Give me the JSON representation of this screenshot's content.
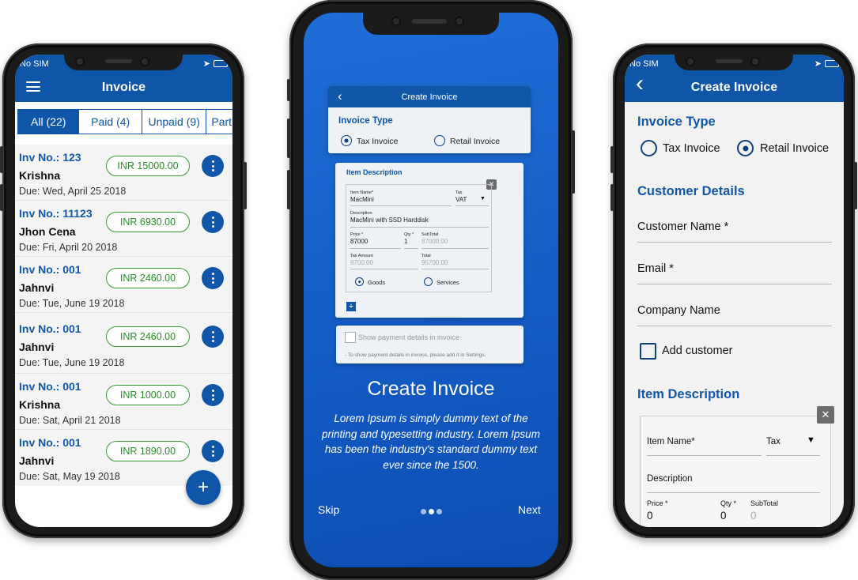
{
  "status": {
    "carrier": "No SIM"
  },
  "left": {
    "title": "Invoice",
    "tabs": [
      {
        "label": "All (22)",
        "active": true
      },
      {
        "label": "Paid (4)",
        "active": false
      },
      {
        "label": "Unpaid (9)",
        "active": false
      },
      {
        "label": "Part",
        "active": false
      }
    ],
    "invoices": [
      {
        "no": "Inv No.: 123",
        "name": "Krishna",
        "due": "Due: Wed, April 25 2018",
        "amount": "INR 15000.00"
      },
      {
        "no": "Inv No.: 11123",
        "name": "Jhon Cena",
        "due": "Due: Fri, April 20 2018",
        "amount": "INR 6930.00"
      },
      {
        "no": "Inv No.: 001",
        "name": "Jahnvi",
        "due": "Due: Tue, June 19 2018",
        "amount": "INR 2460.00"
      },
      {
        "no": "Inv No.: 001",
        "name": "Jahnvi",
        "due": "Due: Tue, June 19 2018",
        "amount": "INR 2460.00"
      },
      {
        "no": "Inv No.: 001",
        "name": "Krishna",
        "due": "Due: Sat, April 21 2018",
        "amount": "INR 1000.00"
      },
      {
        "no": "Inv No.: 001",
        "name": "Jahnvi",
        "due": "Due: Sat, May 19 2018",
        "amount": "INR 1890.00"
      }
    ],
    "fab": "+"
  },
  "center": {
    "mini": {
      "title": "Create Invoice",
      "invoice_type": "Invoice Type",
      "tax_invoice": "Tax Invoice",
      "retail_invoice": "Retail Invoice",
      "item_description": "Item Description",
      "item_name_label": "Item Name*",
      "item_name_value": "MacMini",
      "tax_label": "Tax",
      "tax_value": "VAT",
      "description_label": "Description",
      "description_value": "MacMini with SSD Harddisk",
      "price_label": "Price *",
      "price_value": "87000",
      "qty_label": "Qty *",
      "qty_value": "1",
      "subtotal_label": "SubTotal",
      "subtotal_value": "87000.00",
      "tax_amount_label": "Tax Amount",
      "tax_amount_value": "8700.00",
      "total_label": "Total",
      "total_value": "95700.00",
      "goods": "Goods",
      "services": "Services",
      "show_payment": "Show payment details in invoice",
      "payment_note": "- To show payment details in invoice, please add it in Settings."
    },
    "hero_title": "Create Invoice",
    "hero_body": "Lorem Ipsum is simply dummy text of the printing and typesetting industry. Lorem Ipsum has been the industry's standard dummy text ever since the 1500.",
    "skip": "Skip",
    "next": "Next"
  },
  "right": {
    "title": "Create Invoice",
    "invoice_type": "Invoice Type",
    "tax_invoice": "Tax Invoice",
    "retail_invoice": "Retail Invoice",
    "customer_details": "Customer Details",
    "customer_name": "Customer Name *",
    "email": "Email *",
    "company_name": "Company Name",
    "add_customer": "Add customer",
    "item_description": "Item Description",
    "item_name_label": "Item Name*",
    "tax_label": "Tax",
    "description_label": "Description",
    "price_label": "Price *",
    "price_value": "0",
    "qty_label": "Qty *",
    "qty_value": "0",
    "subtotal_label": "SubTotal",
    "subtotal_value": "0"
  },
  "colors": {
    "primary": "#0f56a8",
    "amount_green": "#2b8a2b"
  }
}
